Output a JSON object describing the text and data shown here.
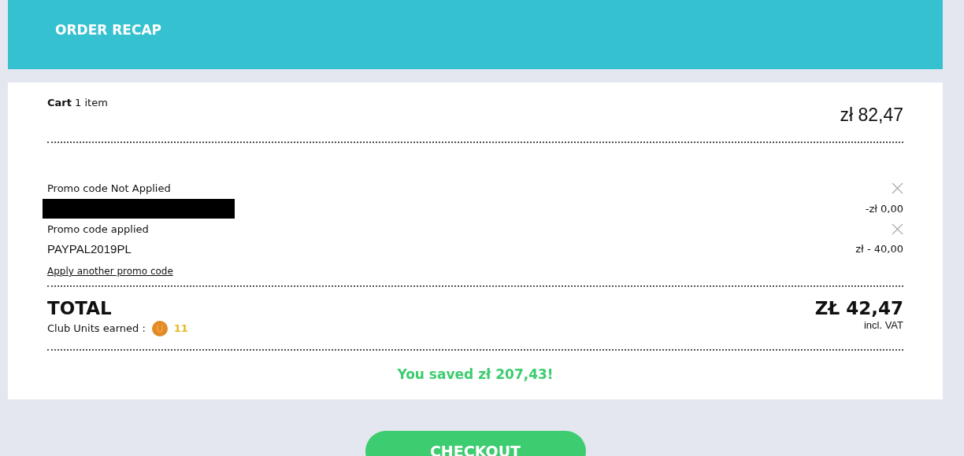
{
  "header": {
    "title": "ORDER RECAP"
  },
  "cart": {
    "label": "Cart",
    "count": "1 item",
    "amount": "zł 82,47"
  },
  "promos": [
    {
      "label": "Promo code Not Applied",
      "kind": "redacted",
      "amount": "-zł 0,00"
    },
    {
      "label": "Promo code applied",
      "kind": "code",
      "code": "PAYPAL2019PL",
      "amount": "zł - 40,00"
    }
  ],
  "apply_link": "Apply another promo code",
  "total": {
    "label": "TOTAL",
    "amount": "ZŁ 42,47",
    "vat": "incl. VAT",
    "units_label": "Club Units earned :",
    "units": "11"
  },
  "savings": "You saved zł 207,43!",
  "checkout_button": "CHECKOUT"
}
